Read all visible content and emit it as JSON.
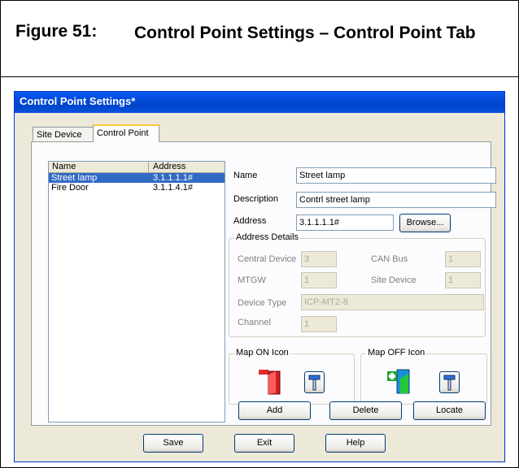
{
  "figure": {
    "number": "Figure 51:",
    "title": "Control Point Settings – Control Point Tab"
  },
  "window": {
    "title": "Control Point Settings*",
    "titlebar_color": "#0054e3"
  },
  "tabs": [
    {
      "label": "Site Device",
      "selected": false
    },
    {
      "label": "Control Point",
      "selected": true
    }
  ],
  "list": {
    "columns": [
      "Name",
      "Address"
    ],
    "rows": [
      {
        "name": "Street lamp",
        "address": "3.1.1.1.1#",
        "selected": true
      },
      {
        "name": "Fire Door",
        "address": "3.1.1.4.1#",
        "selected": false
      }
    ]
  },
  "form": {
    "name_label": "Name",
    "name_value": "Street lamp",
    "description_label": "Description",
    "description_value": "Contrl street lamp",
    "address_label": "Address",
    "address_value": "3.1.1.1.1#",
    "browse_button": "Browse..."
  },
  "address_details": {
    "title": "Address Details",
    "central_device_label": "Central Device",
    "central_device_value": "3",
    "can_bus_label": "CAN Bus",
    "can_bus_value": "1",
    "mtgw_label": "MTGW",
    "mtgw_value": "1",
    "site_device_label": "Site Device",
    "site_device_value": "1",
    "device_type_label": "Device Type",
    "device_type_value": "ICP-MT2-8",
    "channel_label": "Channel",
    "channel_value": "1"
  },
  "map_on": {
    "title": "Map ON Icon"
  },
  "map_off": {
    "title": "Map OFF Icon"
  },
  "actions": {
    "add": "Add",
    "delete": "Delete",
    "locate": "Locate"
  },
  "footer": {
    "save": "Save",
    "exit": "Exit",
    "help": "Help"
  }
}
